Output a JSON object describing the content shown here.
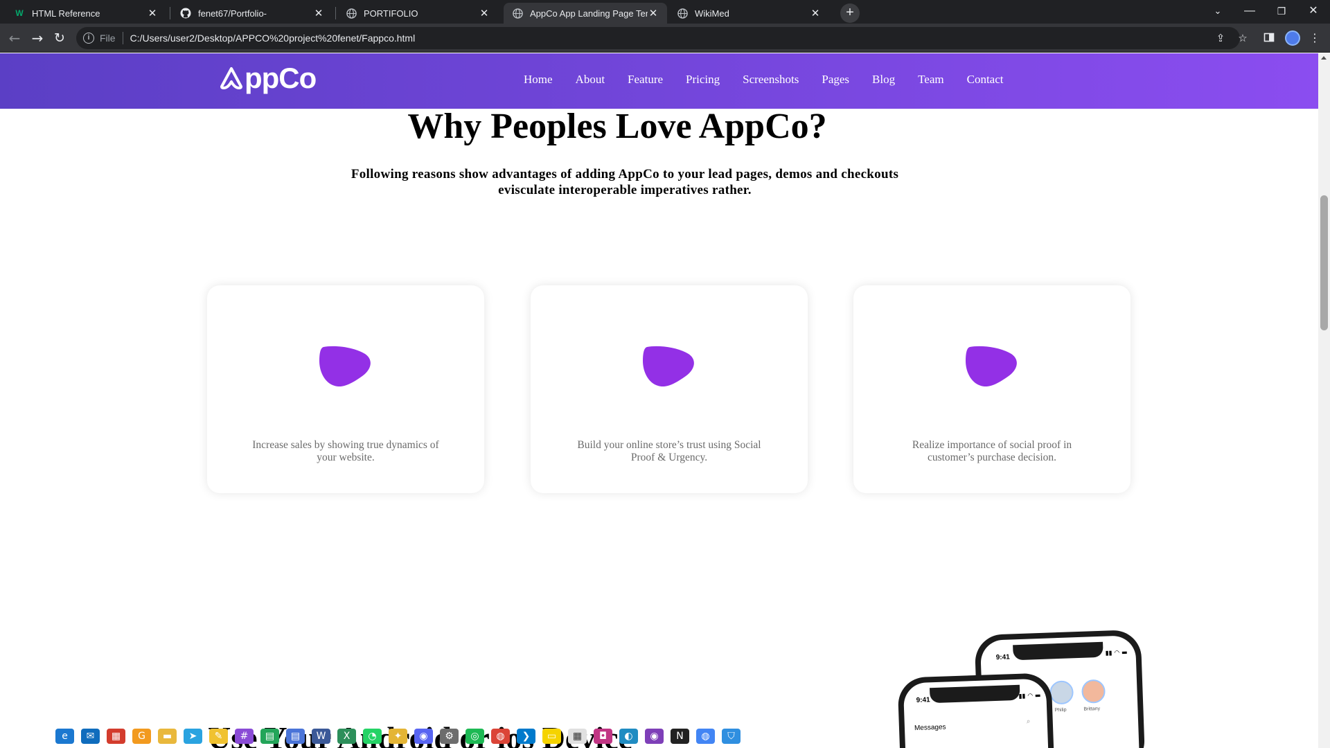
{
  "browser": {
    "tabs": [
      {
        "title": "HTML Reference",
        "icon": "w3schools-icon",
        "active": false
      },
      {
        "title": "fenet67/Portfolio-",
        "icon": "github-icon",
        "active": false
      },
      {
        "title": "PORTIFOLIO",
        "icon": "globe-icon",
        "active": false
      },
      {
        "title": "AppCo App Landing Page Templ",
        "icon": "globe-icon",
        "active": true
      },
      {
        "title": "WikiMed",
        "icon": "globe-icon",
        "active": false
      }
    ],
    "new_tab": "+",
    "address": {
      "scheme_label": "File",
      "url": "C:/Users/user2/Desktop/APPCO%20project%20fenet/Fappco.html"
    }
  },
  "site": {
    "logo": "ppCo",
    "nav": [
      "Home",
      "About",
      "Feature",
      "Pricing",
      "Screenshots",
      "Pages",
      "Blog",
      "Team",
      "Contact"
    ],
    "section_title": "Why Peoples Love AppCo?",
    "section_subtitle": "Following reasons show advantages of adding AppCo to your lead pages, demos and checkouts evisculate interoperable imperatives rather.",
    "cards": [
      {
        "text": "Increase sales by showing true dynamics of your website."
      },
      {
        "text": "Build your online store’s trust using Social Proof & Urgency."
      },
      {
        "text": "Realize importance of social proof in customer’s purchase decision."
      }
    ],
    "next_section_title": "Use Your Android or ios Device",
    "phone": {
      "time": "9:41",
      "messages_label": "Messages",
      "contacts": [
        "Philip",
        "Brittany"
      ]
    }
  },
  "colors": {
    "header_start": "#5b3fc5",
    "header_end": "#8b4df0",
    "blob": "#9330e6",
    "card_text": "#6b6b6b"
  }
}
